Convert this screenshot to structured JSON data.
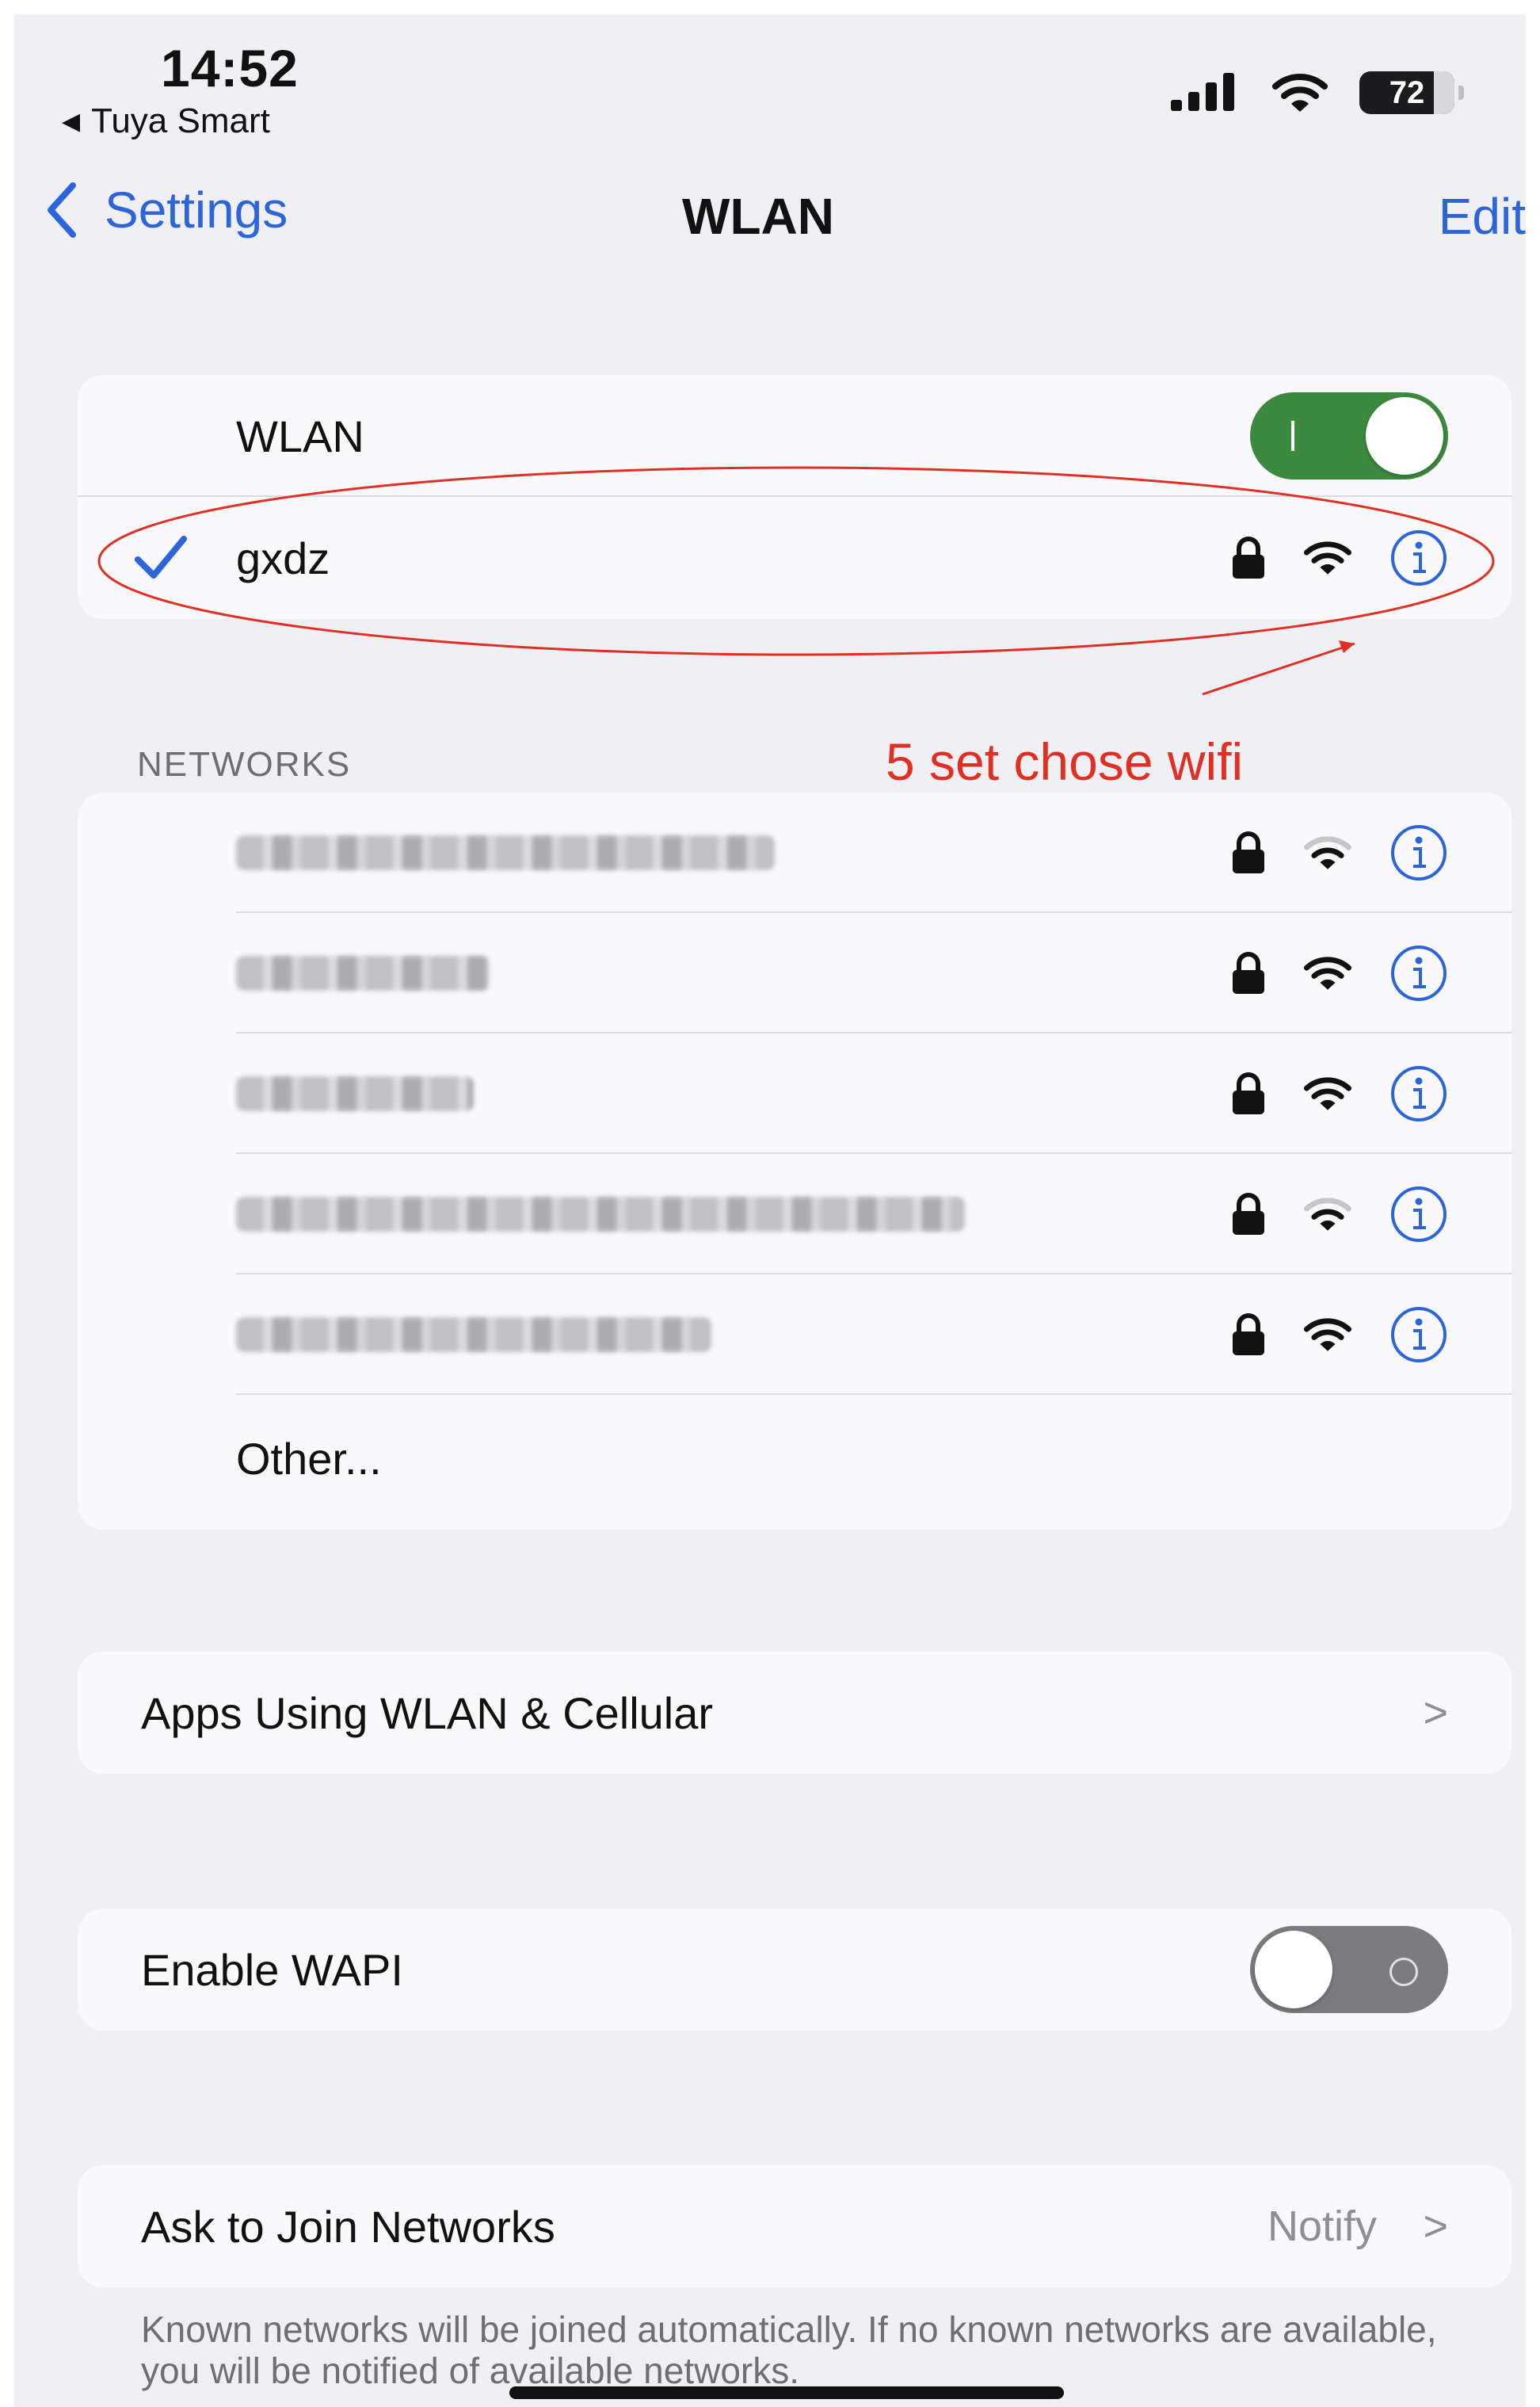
{
  "status_bar": {
    "time": "14:52",
    "back_app": "Tuya Smart",
    "battery": "72"
  },
  "nav": {
    "back_label": "Settings",
    "title": "WLAN",
    "edit_label": "Edit"
  },
  "wlan": {
    "label": "WLAN",
    "enabled": true,
    "connected_network": "gxdz"
  },
  "networks": {
    "header": "NETWORKS",
    "items": [
      {
        "name": "[blurred]",
        "locked": true,
        "signal": 2
      },
      {
        "name": "[blurred]",
        "locked": true,
        "signal": 3
      },
      {
        "name": "[blurred]",
        "locked": true,
        "signal": 3
      },
      {
        "name": "[blurred]",
        "locked": true,
        "signal": 2
      },
      {
        "name": "[blurred]",
        "locked": true,
        "signal": 3
      }
    ],
    "other_label": "Other..."
  },
  "annotation": {
    "text": "5 set chose wifi",
    "color": "#e03024"
  },
  "apps_row": {
    "label": "Apps Using WLAN & Cellular"
  },
  "wapi_row": {
    "label": "Enable WAPI",
    "enabled": false
  },
  "ask_join": {
    "label": "Ask to Join Networks",
    "value": "Notify",
    "footer": "Known networks will be joined automatically. If no known networks are available, you will be notified of available networks."
  },
  "colors": {
    "accent": "#2b65d9",
    "switch_on": "#3c8a3f",
    "switch_off": "#7b7b80",
    "background": "#efeff4"
  },
  "icons": [
    "back-chevron-icon",
    "cellular-signal-icon",
    "wifi-icon",
    "battery-icon",
    "checkmark-icon",
    "lock-icon",
    "info-icon",
    "chevron-right-icon"
  ]
}
